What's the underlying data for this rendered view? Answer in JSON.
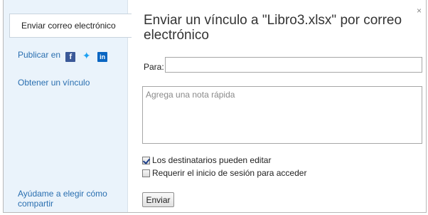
{
  "dialog": {
    "title": "Enviar un vínculo a \"Libro3.xlsx\" por correo electrónico",
    "close_label": "×"
  },
  "sidebar": {
    "items": [
      {
        "label": "Enviar correo electrónico"
      },
      {
        "label": "Publicar en",
        "icons": [
          "facebook-icon",
          "twitter-icon",
          "linkedin-icon"
        ]
      },
      {
        "label": "Obtener un vínculo"
      }
    ],
    "help_label": "Ayúdame a elegir cómo compartir"
  },
  "form": {
    "to_label": "Para:",
    "to_value": "",
    "note_placeholder": "Agrega una nota rápida",
    "checkboxes": [
      {
        "label": "Los destinatarios pueden editar",
        "checked": true
      },
      {
        "label": "Requerir el inicio de sesión para acceder",
        "checked": false
      }
    ],
    "send_label": "Enviar"
  }
}
